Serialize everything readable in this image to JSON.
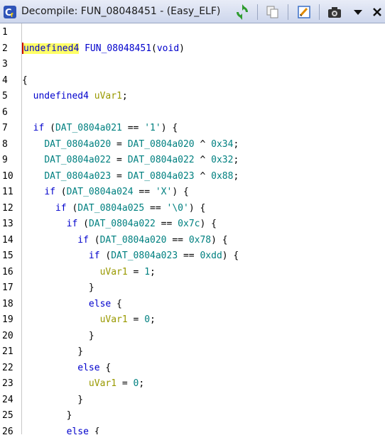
{
  "window": {
    "title": "Decompile: FUN_08048451 - (Easy_ELF)",
    "icons": [
      "decompile-icon",
      "refresh-icon",
      "copy-icon",
      "edit-icon",
      "snapshot-icon",
      "dropdown-arrow-icon",
      "close-icon"
    ]
  },
  "code": {
    "lines": [
      {
        "n": "1",
        "t": []
      },
      {
        "n": "2",
        "t": [
          [
            "ty",
            "undefined4"
          ],
          [
            "pl",
            " "
          ],
          [
            "fn",
            "FUN_08048451"
          ],
          [
            "pl",
            "("
          ],
          [
            "ty",
            "void"
          ],
          [
            "pl",
            ")"
          ]
        ]
      },
      {
        "n": "3",
        "t": []
      },
      {
        "n": "4",
        "t": [
          [
            "pl",
            "{"
          ]
        ]
      },
      {
        "n": "5",
        "t": [
          [
            "pl",
            "  "
          ],
          [
            "ty",
            "undefined4"
          ],
          [
            "pl",
            " "
          ],
          [
            "lv",
            "uVar1"
          ],
          [
            "pl",
            ";"
          ]
        ]
      },
      {
        "n": "6",
        "t": []
      },
      {
        "n": "7",
        "t": [
          [
            "pl",
            "  "
          ],
          [
            "kw",
            "if"
          ],
          [
            "pl",
            " ("
          ],
          [
            "gl",
            "DAT_0804a021"
          ],
          [
            "pl",
            " == "
          ],
          [
            "cn",
            "'1'"
          ],
          [
            "pl",
            ") {"
          ]
        ]
      },
      {
        "n": "8",
        "t": [
          [
            "pl",
            "    "
          ],
          [
            "gl",
            "DAT_0804a020"
          ],
          [
            "pl",
            " = "
          ],
          [
            "gl",
            "DAT_0804a020"
          ],
          [
            "pl",
            " ^ "
          ],
          [
            "cn",
            "0x34"
          ],
          [
            "pl",
            ";"
          ]
        ]
      },
      {
        "n": "9",
        "t": [
          [
            "pl",
            "    "
          ],
          [
            "gl",
            "DAT_0804a022"
          ],
          [
            "pl",
            " = "
          ],
          [
            "gl",
            "DAT_0804a022"
          ],
          [
            "pl",
            " ^ "
          ],
          [
            "cn",
            "0x32"
          ],
          [
            "pl",
            ";"
          ]
        ]
      },
      {
        "n": "10",
        "t": [
          [
            "pl",
            "    "
          ],
          [
            "gl",
            "DAT_0804a023"
          ],
          [
            "pl",
            " = "
          ],
          [
            "gl",
            "DAT_0804a023"
          ],
          [
            "pl",
            " ^ "
          ],
          [
            "cn",
            "0x88"
          ],
          [
            "pl",
            ";"
          ]
        ]
      },
      {
        "n": "11",
        "t": [
          [
            "pl",
            "    "
          ],
          [
            "kw",
            "if"
          ],
          [
            "pl",
            " ("
          ],
          [
            "gl",
            "DAT_0804a024"
          ],
          [
            "pl",
            " == "
          ],
          [
            "cn",
            "'X'"
          ],
          [
            "pl",
            ") {"
          ]
        ]
      },
      {
        "n": "12",
        "t": [
          [
            "pl",
            "      "
          ],
          [
            "kw",
            "if"
          ],
          [
            "pl",
            " ("
          ],
          [
            "gl",
            "DAT_0804a025"
          ],
          [
            "pl",
            " == "
          ],
          [
            "cn",
            "'\\0'"
          ],
          [
            "pl",
            ") {"
          ]
        ]
      },
      {
        "n": "13",
        "t": [
          [
            "pl",
            "        "
          ],
          [
            "kw",
            "if"
          ],
          [
            "pl",
            " ("
          ],
          [
            "gl",
            "DAT_0804a022"
          ],
          [
            "pl",
            " == "
          ],
          [
            "cn",
            "0x7c"
          ],
          [
            "pl",
            ") {"
          ]
        ]
      },
      {
        "n": "14",
        "t": [
          [
            "pl",
            "          "
          ],
          [
            "kw",
            "if"
          ],
          [
            "pl",
            " ("
          ],
          [
            "gl",
            "DAT_0804a020"
          ],
          [
            "pl",
            " == "
          ],
          [
            "cn",
            "0x78"
          ],
          [
            "pl",
            ") {"
          ]
        ]
      },
      {
        "n": "15",
        "t": [
          [
            "pl",
            "            "
          ],
          [
            "kw",
            "if"
          ],
          [
            "pl",
            " ("
          ],
          [
            "gl",
            "DAT_0804a023"
          ],
          [
            "pl",
            " == "
          ],
          [
            "cn",
            "0xdd"
          ],
          [
            "pl",
            ") {"
          ]
        ]
      },
      {
        "n": "16",
        "t": [
          [
            "pl",
            "              "
          ],
          [
            "lv",
            "uVar1"
          ],
          [
            "pl",
            " = "
          ],
          [
            "cn",
            "1"
          ],
          [
            "pl",
            ";"
          ]
        ]
      },
      {
        "n": "17",
        "t": [
          [
            "pl",
            "            }"
          ]
        ]
      },
      {
        "n": "18",
        "t": [
          [
            "pl",
            "            "
          ],
          [
            "kw",
            "else"
          ],
          [
            "pl",
            " {"
          ]
        ]
      },
      {
        "n": "19",
        "t": [
          [
            "pl",
            "              "
          ],
          [
            "lv",
            "uVar1"
          ],
          [
            "pl",
            " = "
          ],
          [
            "cn",
            "0"
          ],
          [
            "pl",
            ";"
          ]
        ]
      },
      {
        "n": "20",
        "t": [
          [
            "pl",
            "            }"
          ]
        ]
      },
      {
        "n": "21",
        "t": [
          [
            "pl",
            "          }"
          ]
        ]
      },
      {
        "n": "22",
        "t": [
          [
            "pl",
            "          "
          ],
          [
            "kw",
            "else"
          ],
          [
            "pl",
            " {"
          ]
        ]
      },
      {
        "n": "23",
        "t": [
          [
            "pl",
            "            "
          ],
          [
            "lv",
            "uVar1"
          ],
          [
            "pl",
            " = "
          ],
          [
            "cn",
            "0"
          ],
          [
            "pl",
            ";"
          ]
        ]
      },
      {
        "n": "24",
        "t": [
          [
            "pl",
            "          }"
          ]
        ]
      },
      {
        "n": "25",
        "t": [
          [
            "pl",
            "        }"
          ]
        ]
      },
      {
        "n": "26",
        "t": [
          [
            "pl",
            "        "
          ],
          [
            "kw",
            "else"
          ],
          [
            "pl",
            " {"
          ]
        ]
      }
    ]
  }
}
